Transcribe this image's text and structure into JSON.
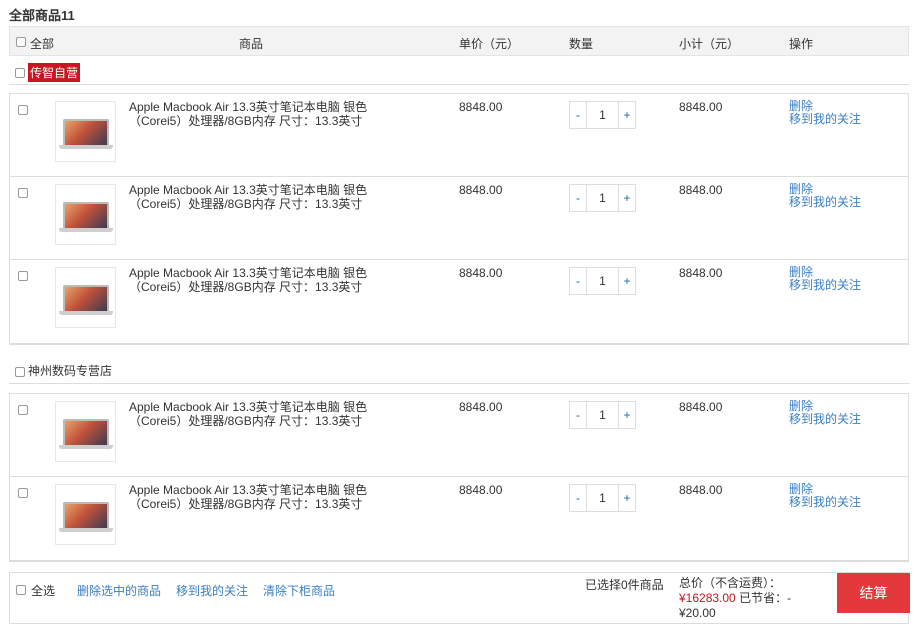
{
  "title": "全部商品11",
  "header": {
    "all": "全部",
    "product": "商品",
    "unit_price": "单价（元）",
    "quantity": "数量",
    "subtotal": "小计（元）",
    "operation": "操作"
  },
  "shops": [
    {
      "name": "传智自营",
      "items": [
        {
          "name": "Apple Macbook Air 13.3英寸笔记本电脑 银色（Corei5）处理器/8GB内存 尺寸：13.3英寸",
          "price": "8848.00",
          "qty": "1",
          "subtotal": "8848.00"
        },
        {
          "name": "Apple Macbook Air 13.3英寸笔记本电脑 银色（Corei5）处理器/8GB内存 尺寸：13.3英寸",
          "price": "8848.00",
          "qty": "1",
          "subtotal": "8848.00"
        },
        {
          "name": "Apple Macbook Air 13.3英寸笔记本电脑 银色（Corei5）处理器/8GB内存 尺寸：13.3英寸",
          "price": "8848.00",
          "qty": "1",
          "subtotal": "8848.00"
        }
      ]
    },
    {
      "name": "神州数码专营店",
      "items": [
        {
          "name": "Apple Macbook Air 13.3英寸笔记本电脑 银色（Corei5）处理器/8GB内存 尺寸：13.3英寸",
          "price": "8848.00",
          "qty": "1",
          "subtotal": "8848.00"
        },
        {
          "name": "Apple Macbook Air 13.3英寸笔记本电脑 银色（Corei5）处理器/8GB内存 尺寸：13.3英寸",
          "price": "8848.00",
          "qty": "1",
          "subtotal": "8848.00"
        }
      ]
    }
  ],
  "ops": {
    "delete": "删除",
    "move": "移到我的关注",
    "minus": "-",
    "plus": "+"
  },
  "footer": {
    "select_all": "全选",
    "delete_selected": "删除选中的商品",
    "move_to_follow": "移到我的关注",
    "clear_cart": "清除下柜商品",
    "selected_count": "已选择0件商品",
    "total_label": "总价（不含运费）：",
    "total_value": "¥16283.00",
    "saved_label": "已节省：-",
    "saved_value": "¥20.00",
    "checkout": "结算"
  },
  "colors": {
    "brand_red": "#c81623",
    "checkout_red": "#e4393c",
    "link_blue": "#3a7fc4"
  }
}
